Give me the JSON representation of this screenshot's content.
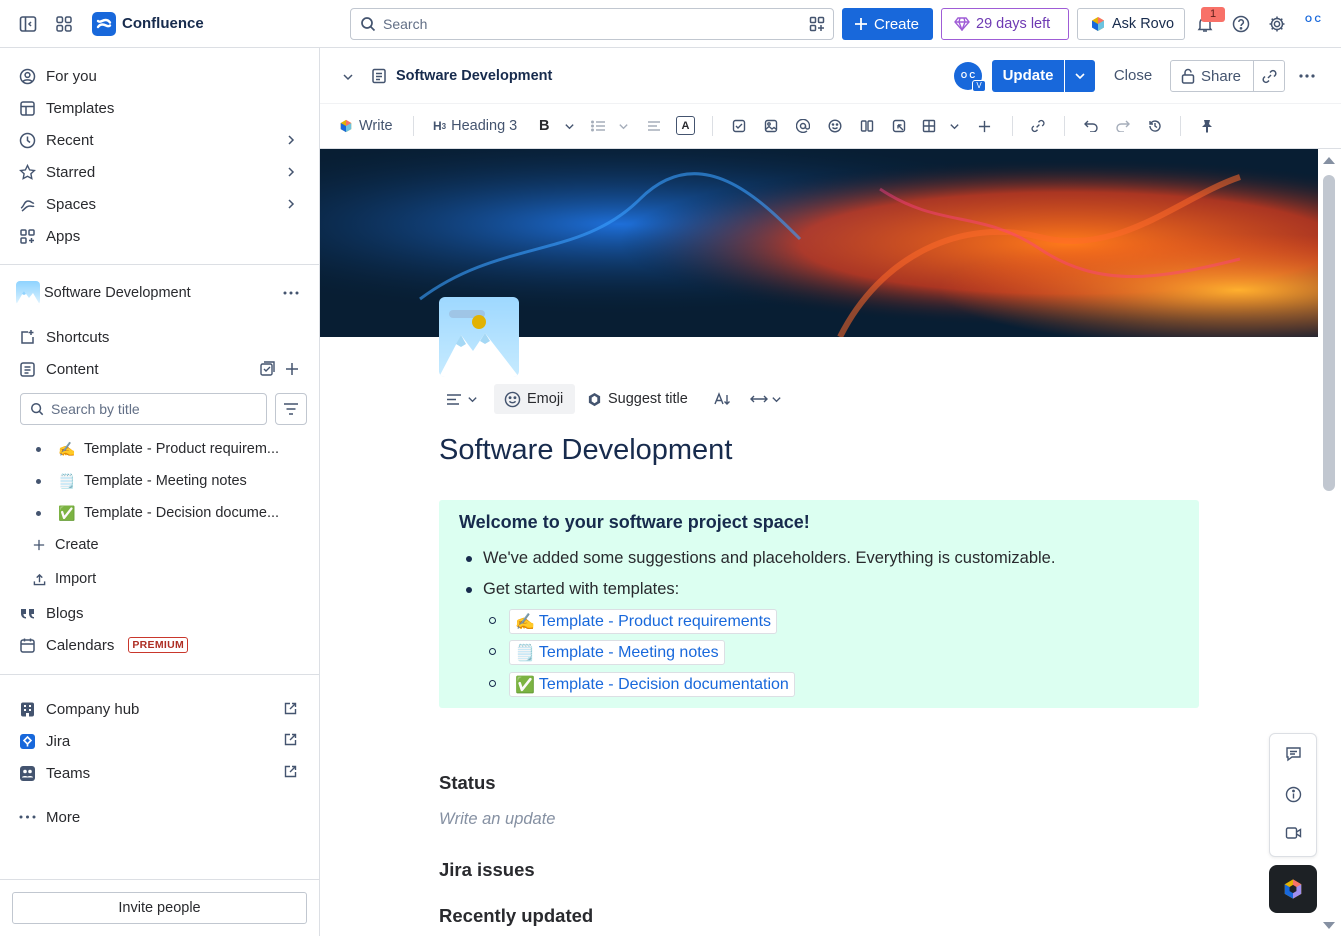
{
  "topbar": {
    "app_name": "Confluence",
    "search_placeholder": "Search",
    "create_label": "Create",
    "trial_label": "29 days left",
    "rovo_label": "Ask Rovo",
    "notification_count": "1",
    "avatar_initials": "O C"
  },
  "sidebar": {
    "nav": [
      {
        "label": "For you",
        "icon": "user-circle-icon"
      },
      {
        "label": "Templates",
        "icon": "template-icon"
      },
      {
        "label": "Recent",
        "icon": "clock-icon"
      },
      {
        "label": "Starred",
        "icon": "star-icon"
      },
      {
        "label": "Spaces",
        "icon": "spaces-icon"
      },
      {
        "label": "Apps",
        "icon": "apps-icon"
      }
    ],
    "space_name": "Software Development",
    "shortcuts_label": "Shortcuts",
    "content_label": "Content",
    "search_placeholder": "Search by title",
    "tree": [
      {
        "emoji": "✍️",
        "label": "Template - Product requirem..."
      },
      {
        "emoji": "🗒️",
        "label": "Template - Meeting notes"
      },
      {
        "emoji": "✅",
        "label": "Template - Decision docume..."
      }
    ],
    "create_label": "Create",
    "import_label": "Import",
    "blogs_label": "Blogs",
    "calendars_label": "Calendars",
    "premium_label": "PREMIUM",
    "apps_links": [
      {
        "label": "Company hub",
        "icon": "building-icon"
      },
      {
        "label": "Jira",
        "icon": "jira-icon"
      },
      {
        "label": "Teams",
        "icon": "teams-icon"
      }
    ],
    "more_label": "More",
    "invite_label": "Invite people"
  },
  "header": {
    "page_name": "Software Development",
    "collaborator_initials": "O C",
    "collaborator_badge": "V",
    "update_label": "Update",
    "close_label": "Close",
    "share_label": "Share"
  },
  "toolbar": {
    "write_label": "Write",
    "heading_label": "Heading 3",
    "bold_label": "B",
    "text_color_label": "A"
  },
  "page": {
    "emoji_label": "Emoji",
    "suggest_title_label": "Suggest title",
    "title": "Software Development",
    "panel": {
      "heading": "Welcome to your software project space!",
      "line1": "We've added some suggestions and placeholders. Everything is customizable.",
      "line2": "Get started with templates:",
      "links": [
        {
          "emoji": "✍️",
          "label": "Template - Product requirements"
        },
        {
          "emoji": "🗒️",
          "label": "Template - Meeting notes"
        },
        {
          "emoji": "✅",
          "label": "Template - Decision documentation"
        }
      ]
    },
    "status_heading": "Status",
    "status_placeholder": "Write an update",
    "jira_heading": "Jira issues",
    "recent_heading": "Recently updated"
  },
  "colors": {
    "brand": "#1868db",
    "panel_bg": "#dcfff1",
    "trial": "#9f5cd6"
  }
}
